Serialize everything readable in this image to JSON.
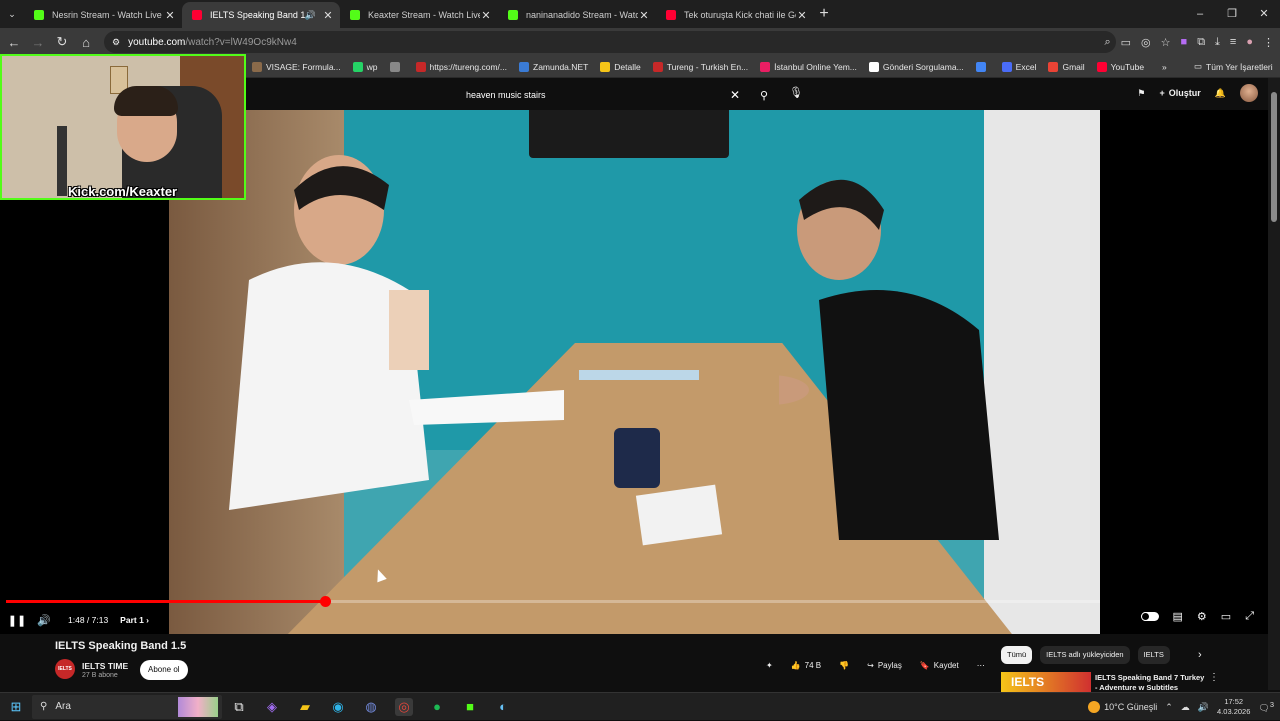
{
  "browser": {
    "tabs": [
      {
        "title": "Nesrin Stream - Watch Live on",
        "icon": "kick-icon",
        "color": "#53fc18",
        "active": false
      },
      {
        "title": "IELTS Speaking Band 1.5 - Y",
        "icon": "youtube-icon",
        "color": "#ff0033",
        "active": true,
        "audio": true
      },
      {
        "title": "Keaxter Stream - Watch Live on",
        "icon": "kick-icon",
        "color": "#53fc18",
        "active": false
      },
      {
        "title": "naninanadido Stream - Watch",
        "icon": "kick-icon",
        "color": "#53fc18",
        "active": false
      },
      {
        "title": "Tek oturuşta Kick chati ile God",
        "icon": "youtube-icon",
        "color": "#ff0033",
        "active": false
      }
    ],
    "url_host": "youtube.com",
    "url_path": "/watch?v=lW49Oc9kNw4",
    "bookmarks": [
      {
        "label": "VISAGE: Formula...",
        "color": "#8a6a4a"
      },
      {
        "label": "wp",
        "color": "#25d366"
      },
      {
        "label": "",
        "color": "#888888"
      },
      {
        "label": "https://tureng.com/...",
        "color": "#c62828"
      },
      {
        "label": "Zamunda.NET",
        "color": "#3a7bd5"
      },
      {
        "label": "Detalle",
        "color": "#f5c518"
      },
      {
        "label": "Tureng - Turkish En...",
        "color": "#c62828"
      },
      {
        "label": "İstanbul Online Yem...",
        "color": "#e91e63"
      },
      {
        "label": "Gönderi Sorgulama...",
        "color": "#ffffff"
      },
      {
        "label": "",
        "color": "#4285f4"
      },
      {
        "label": "Excel",
        "color": "#4a6cf7"
      },
      {
        "label": "Gmail",
        "color": "#ea4335"
      },
      {
        "label": "YouTube",
        "color": "#ff0033"
      }
    ],
    "all_bookmarks": "Tüm Yer İşaretleri"
  },
  "youtube": {
    "search_query": "heaven music stairs",
    "create_label": "Oluştur",
    "player": {
      "current_time": "1:48",
      "duration": "7:13",
      "time_display": "1:48 / 7:13",
      "chapter": "Part 1",
      "progress_fraction": 0.2915
    },
    "video_title": "IELTS Speaking Band 1.5",
    "channel": {
      "name": "IELTS TIME",
      "subscribers": "27 B abone",
      "avatar_text": "IELTS",
      "subscribe_label": "Abone ol"
    },
    "actions": {
      "likes": "74 B",
      "share": "Paylaş",
      "save": "Kaydet"
    },
    "chips": [
      "Tümü",
      "IELTS adlı yükleyiciden",
      "IELTS"
    ],
    "recommendation": {
      "title": "IELTS Speaking Band 7 Turkey - Adventure w Subtitles",
      "thumb_text": "IELTS"
    }
  },
  "overlay": {
    "kick_label": "Kick.com/Keaxter",
    "accent": "#53fc18"
  },
  "taskbar": {
    "search_placeholder": "Ara",
    "weather": "10°C  Güneşli",
    "time": "17:52",
    "date": "4.03.2026",
    "notifications": "3"
  }
}
